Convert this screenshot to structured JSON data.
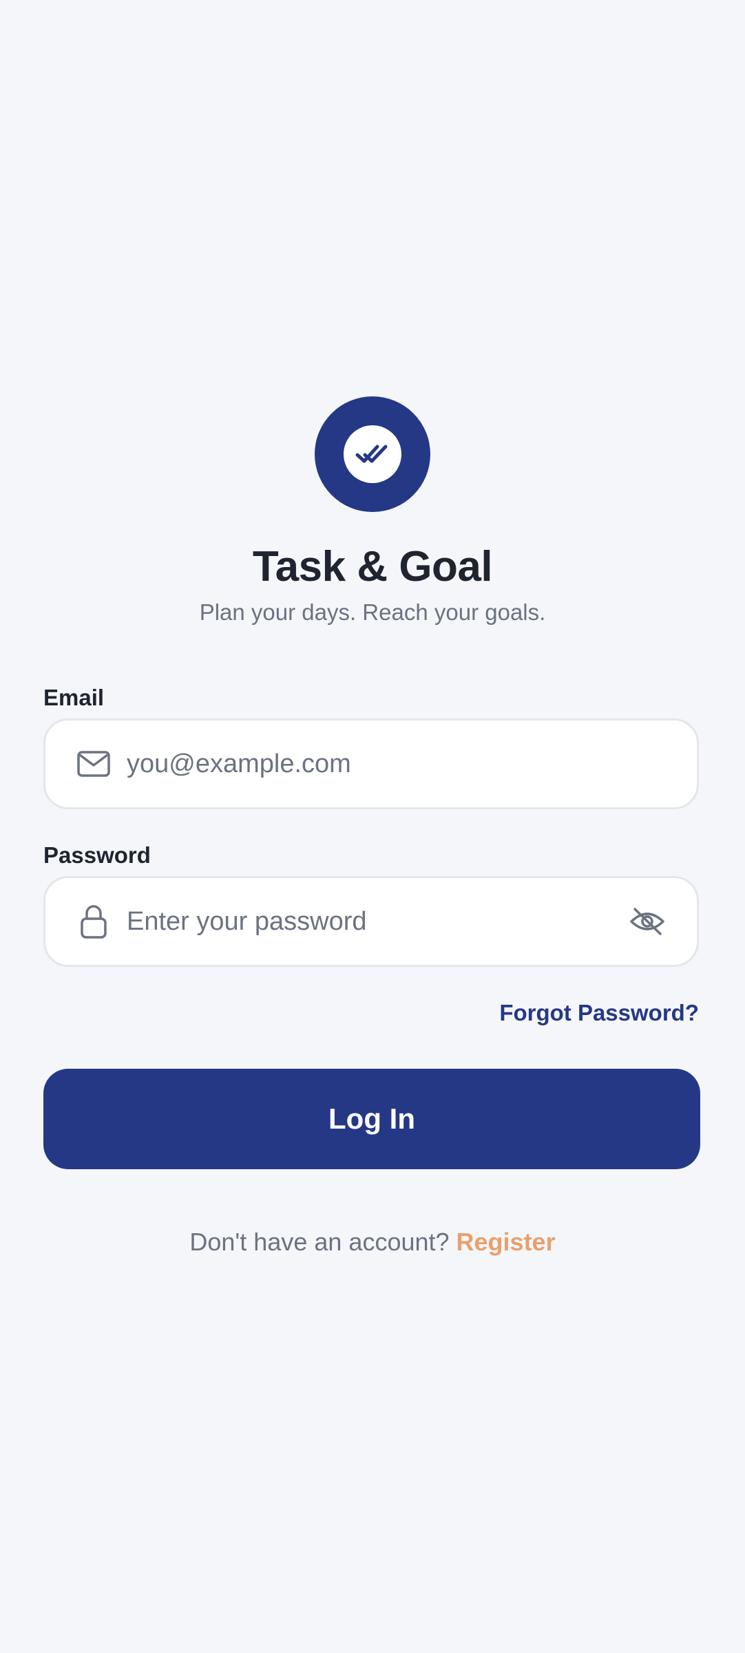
{
  "app": {
    "title": "Task & Goal",
    "subtitle": "Plan your days. Reach your goals.",
    "logo_icon": "double-check-icon"
  },
  "email": {
    "label": "Email",
    "placeholder": "you@example.com",
    "value": "",
    "icon": "mail-icon"
  },
  "password": {
    "label": "Password",
    "placeholder": "Enter your password",
    "value": "",
    "icon": "lock-icon",
    "toggle_icon": "eye-off-icon"
  },
  "links": {
    "forgot": "Forgot Password?"
  },
  "login": {
    "label": "Log In"
  },
  "register": {
    "prompt": "Don't have an account?",
    "link": "Register"
  },
  "colors": {
    "primary": "#253885",
    "accent": "#e9a06c",
    "background": "#f4f6fa",
    "text": "#1f2430",
    "muted": "#6b7280"
  }
}
